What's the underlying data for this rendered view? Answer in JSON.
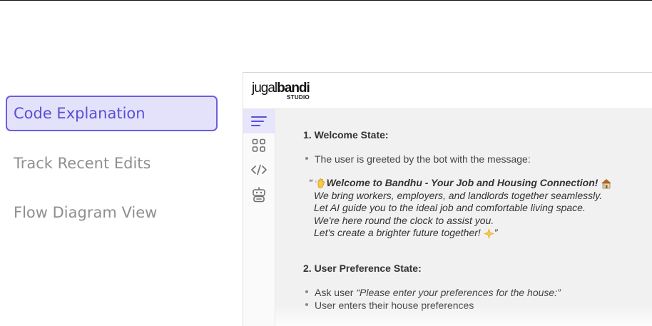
{
  "menu": {
    "items": [
      {
        "label": "Code Explanation",
        "active": true
      },
      {
        "label": "Track Recent Edits",
        "active": false
      },
      {
        "label": "Flow Diagram View",
        "active": false
      }
    ]
  },
  "app": {
    "brand": {
      "name_light": "jugal",
      "name_bold": "bandi",
      "sub": "STUDIO"
    },
    "rail": [
      "lines-icon",
      "grid-icon",
      "code-icon",
      "bot-icon"
    ],
    "content": {
      "section1": {
        "heading": "1. Welcome State:",
        "bullet": "The user is greeted by the bot with the message:",
        "quote_open": "“",
        "quote_title": "Welcome to Bandhu - Your Job and Housing Connection!",
        "quote_lines": [
          "We bring workers, employers, and landlords together seamlessly.",
          "Let AI guide you to the ideal job and comfortable living space.",
          "We're here round the clock to assist you."
        ],
        "quote_last": "Let's create a brighter future together!",
        "quote_close": "”"
      },
      "section2": {
        "heading": "2. User Preference State:",
        "bullet1_prefix": "Ask user ",
        "bullet1_quote": "“Please enter your preferences for the house:”",
        "bullet2": "User enters their house preferences"
      }
    }
  }
}
